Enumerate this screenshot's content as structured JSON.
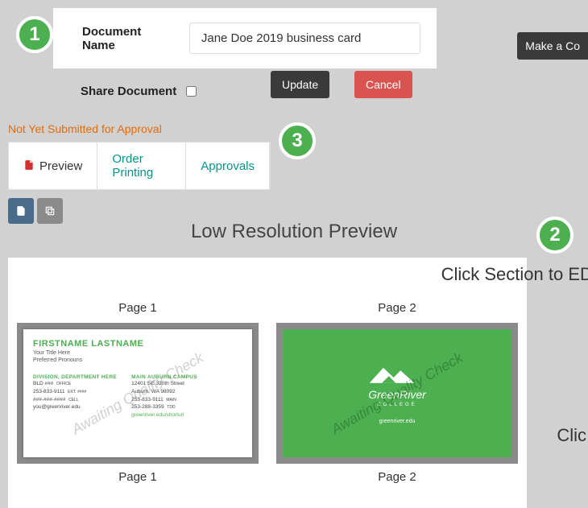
{
  "badges": {
    "one": "1",
    "two": "2",
    "three": "3"
  },
  "form": {
    "doc_name_label": "Document Name",
    "doc_name_value": "Jane Doe 2019 business card",
    "share_label": "Share Document",
    "update": "Update",
    "cancel": "Cancel",
    "make_copy": "Make a Co"
  },
  "status": "Not Yet Submitted for Approval",
  "tabs": {
    "preview": "Preview",
    "order": "Order Printing",
    "approvals": "Approvals"
  },
  "preview": {
    "title": "Low Resolution Preview",
    "click_section": "Click Section to EDI",
    "click_below": "Clic",
    "page1_top": "Page 1",
    "page2_top": "Page 2",
    "page1_bottom": "Page 1",
    "page2_bottom": "Page 2",
    "watermark": "Awaiting Quality Check"
  },
  "card_front": {
    "name": "FIRSTNAME LASTNAME",
    "title": "Your Title Here",
    "pronouns": "Preferred Pronouns",
    "left_header": "DIVISION, DEPARTMENT HERE",
    "left_bld": "BLD ###",
    "left_office": "OFFICE",
    "left_phone1": "253-833-9111",
    "left_ext": "EXT. ####",
    "left_phone2": "###-###-####",
    "left_cell": "CELL",
    "left_email": "you@greenriver.edu",
    "right_header": "MAIN AUBURN CAMPUS",
    "right_addr1": "12401 SE 320th Street",
    "right_addr2": "Auburn, WA 98092",
    "right_phone1": "253-833-9111",
    "right_phone2": "253-288-3359",
    "right_main": "MAIN",
    "right_tdd": "TDD",
    "right_url": "greenriver.edu/shorturl"
  },
  "card_back": {
    "logo": "GreenRiver",
    "sub": "COLLEGE",
    "url": "greenriver.edu"
  }
}
